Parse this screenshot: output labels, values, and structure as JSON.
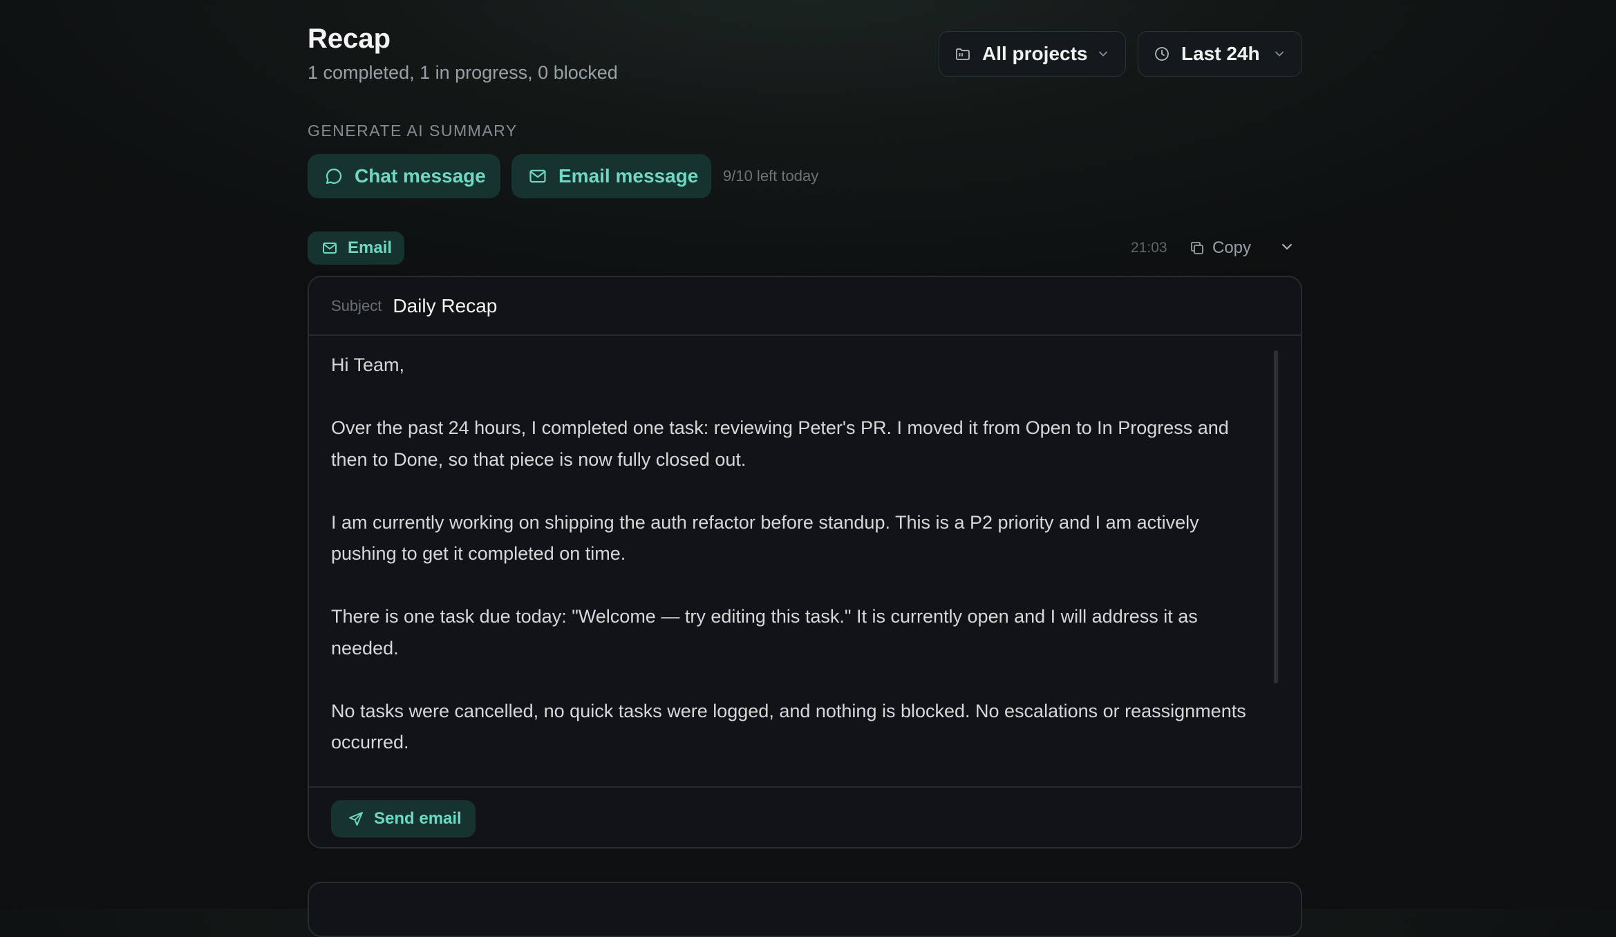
{
  "header": {
    "title": "Recap",
    "summary": "1 completed, 1 in progress, 0 blocked",
    "project_filter": {
      "value": "All projects",
      "icon": "folder-icon"
    },
    "time_filter": {
      "value": "Last 24h",
      "icon": "clock-icon"
    }
  },
  "generate": {
    "label": "GENERATE AI SUMMARY",
    "chat_button": "Chat message",
    "email_button": "Email message",
    "quota": "9/10 left today"
  },
  "result": {
    "type_tag": "Email",
    "time": "21:03",
    "copy_label": "Copy",
    "subject_label": "Subject",
    "subject": "Daily Recap",
    "body": [
      "Hi Team,",
      "Over the past 24 hours, I completed one task: reviewing Peter's PR. I moved it from Open to In Progress and then to Done, so that piece is now fully closed out.",
      "I am currently working on shipping the auth refactor before standup. This is a P2 priority and I am actively pushing to get it completed on time.",
      "There is one task due today: \"Welcome — try editing this task.\" It is currently open and I will address it as needed.",
      "No tasks were cancelled, no quick tasks were logged, and nothing is blocked. No escalations or reassignments occurred."
    ],
    "send_label": "Send email"
  },
  "colors": {
    "accent": "#6fd8c2",
    "accent_bg": "#173330",
    "background": "#0d0f10",
    "card": "#121316"
  }
}
